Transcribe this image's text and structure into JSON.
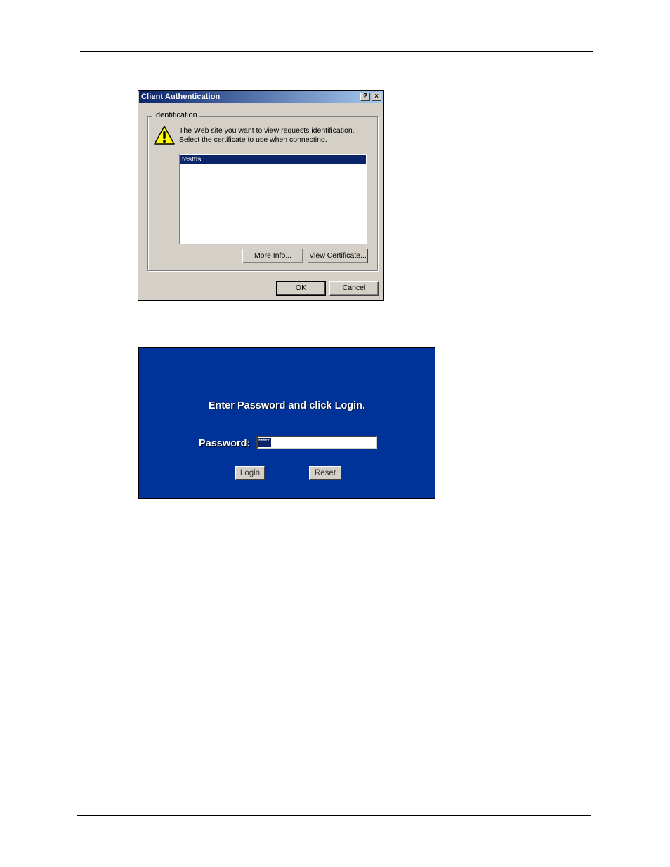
{
  "dialog": {
    "title": "Client Authentication",
    "help_label": "?",
    "close_label": "×",
    "group_label": "Identification",
    "prompt_line1": "The Web site you want to view requests identification.",
    "prompt_line2": "Select the certificate to use when connecting.",
    "certificates": [
      "testtls"
    ],
    "more_info_label": "More Info...",
    "view_certificate_label": "View Certificate...",
    "ok_label": "OK",
    "cancel_label": "Cancel",
    "icon": "warning-icon"
  },
  "login": {
    "heading": "Enter Password and click Login.",
    "password_label": "Password:",
    "password_value": "*****",
    "login_label": "Login",
    "reset_label": "Reset",
    "colors": {
      "background": "#003399",
      "text": "#ffffff"
    }
  }
}
